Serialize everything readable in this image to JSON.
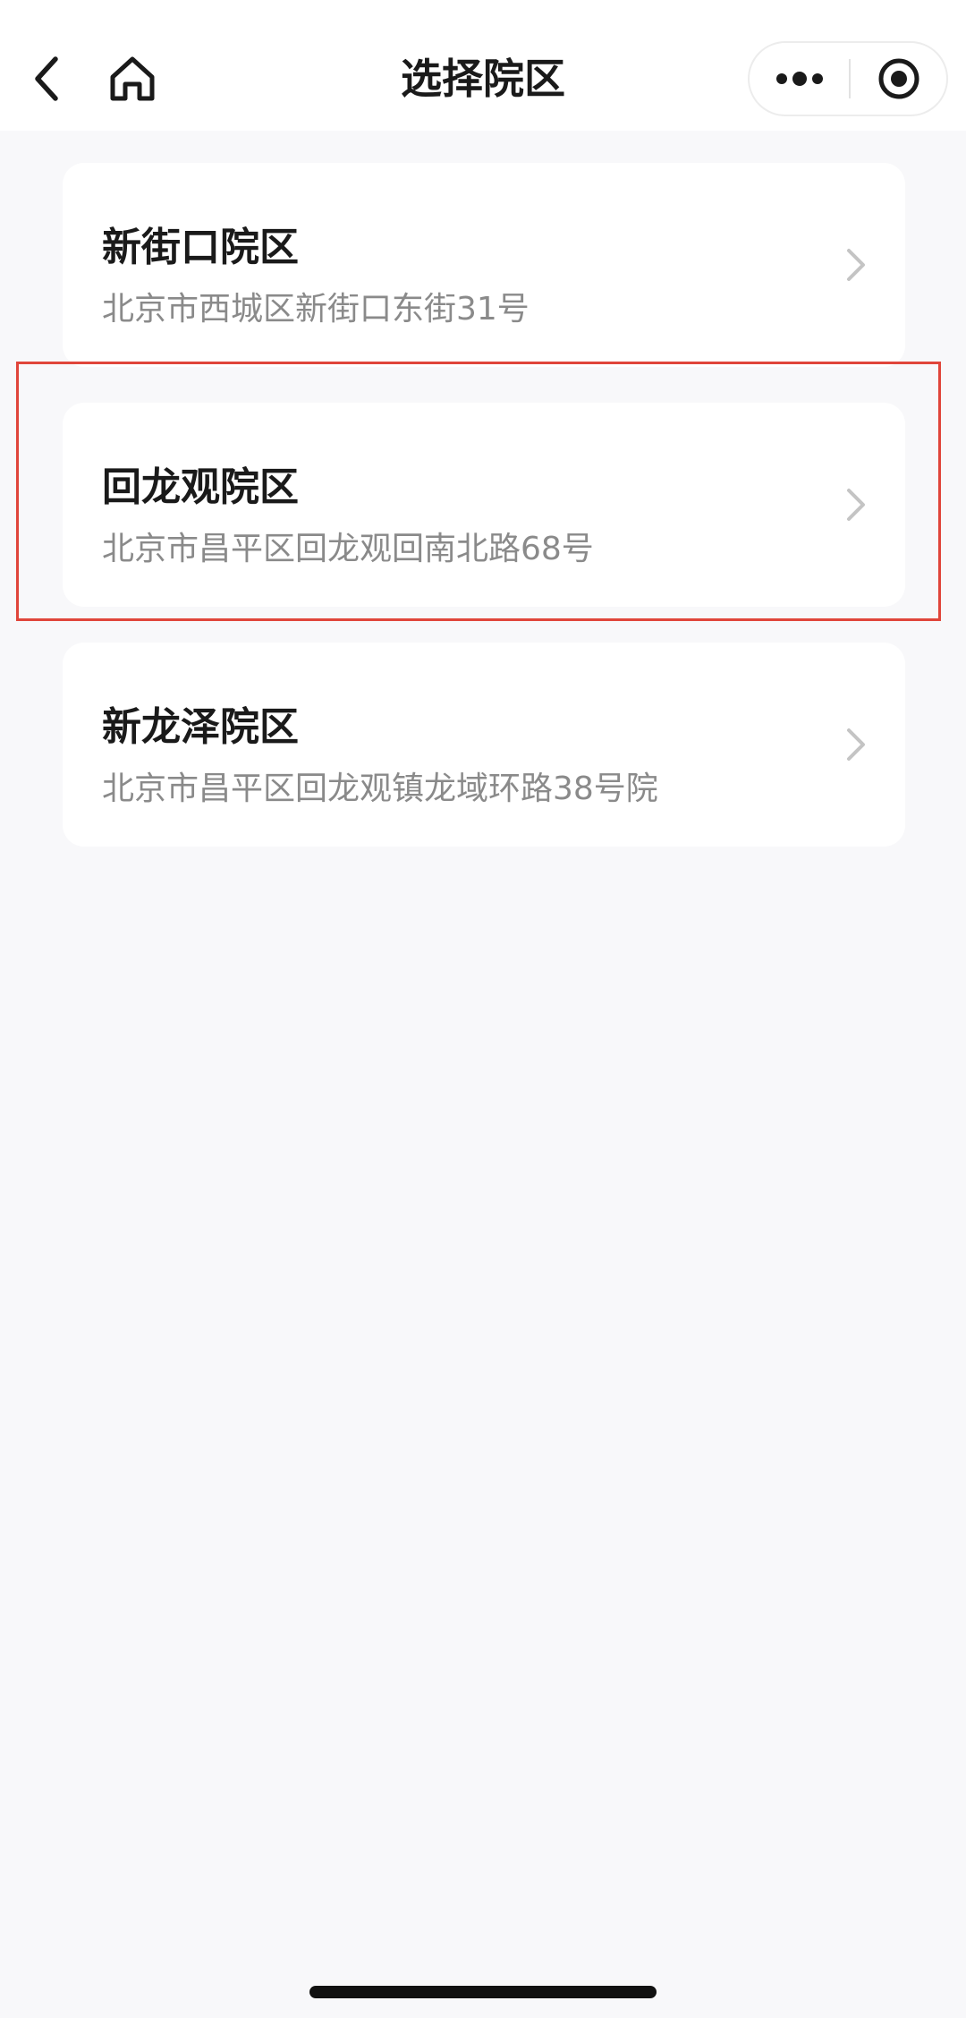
{
  "header": {
    "title": "选择院区",
    "back_icon": "chevron-left-icon",
    "home_icon": "home-icon",
    "more_icon": "more-dots-icon",
    "close_icon": "target-circle-icon"
  },
  "campuses": [
    {
      "name": "新街口院区",
      "address": "北京市西城区新街口东街31号"
    },
    {
      "name": "回龙观院区",
      "address": "北京市昌平区回龙观回南北路68号",
      "highlighted": true
    },
    {
      "name": "新龙泽院区",
      "address": "北京市昌平区回龙观镇龙域环路38号院"
    }
  ],
  "colors": {
    "background": "#f8f8fa",
    "card": "#ffffff",
    "title_text": "#1a1a1a",
    "address_text": "#8a8a8a",
    "highlight_border": "#e0453a",
    "chevron": "#c4c4c4"
  }
}
